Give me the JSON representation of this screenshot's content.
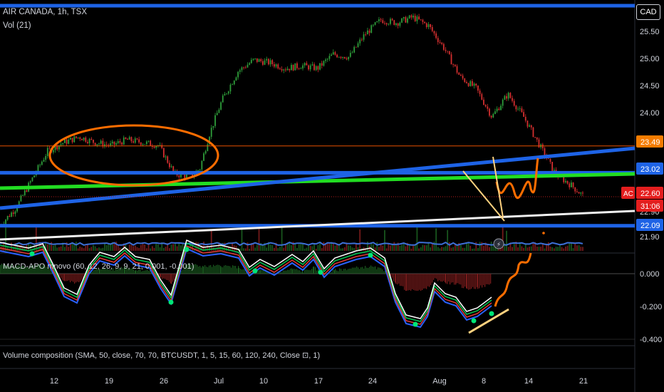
{
  "header": {
    "symbol_line": "AIR CANADA, 1h, TSX",
    "volume_label": "Vol (21)",
    "currency": "CAD"
  },
  "panes": {
    "macd_label": "MACD-APO mnovo (60, 12, 26, 9, 9, 21, 0.001, -0.001)",
    "volume_composition_label": "Volume composition (SMA, 50, close, 70, 70, BTCUSDT, 1, 5, 15, 60, 120, 240, Close ⊡, 1)"
  },
  "colors": {
    "up": "#26a69a",
    "up_candle": "#2e9d3a",
    "down": "#d32f2f",
    "blue_line": "#1e63e6",
    "green_line": "#22dd22",
    "orange": "#ff6d00",
    "white_line": "#f0f0f0",
    "yellow_marker": "#ffd27f",
    "price_tag_current": "#e41e1e",
    "price_tag_orange": "#f57c00",
    "price_tag_blue": "#1e63e6",
    "axis_text": "#d1d4dc"
  },
  "chart_data": [
    {
      "type": "candlestick",
      "title": "AIR CANADA, 1h, TSX",
      "y_axis_ticks": [
        "25.50",
        "25.00",
        "24.50",
        "24.00",
        "22.90",
        "21.90"
      ],
      "ylim": [
        21.8,
        25.8
      ],
      "x_axis_ticks": [
        "12",
        "19",
        "26",
        "Jul",
        "10",
        "17",
        "24",
        "Aug",
        "8",
        "14",
        "21"
      ],
      "price_labels": [
        {
          "value": "23.49",
          "style": "orange"
        },
        {
          "value": "23.02",
          "style": "blue"
        },
        {
          "value": "22.60",
          "style": "current",
          "symbol": "AC"
        },
        {
          "value": "31:06",
          "style": "countdown"
        },
        {
          "value": "22.09",
          "style": "blue"
        }
      ],
      "close_path": [
        {
          "x": 0,
          "y": 22.1
        },
        {
          "x": 5,
          "y": 22.4
        },
        {
          "x": 10,
          "y": 22.9
        },
        {
          "x": 15,
          "y": 23.4
        },
        {
          "x": 20,
          "y": 23.55
        },
        {
          "x": 25,
          "y": 23.65
        },
        {
          "x": 30,
          "y": 23.55
        },
        {
          "x": 35,
          "y": 23.5
        },
        {
          "x": 40,
          "y": 23.6
        },
        {
          "x": 45,
          "y": 23.55
        },
        {
          "x": 50,
          "y": 23.5
        },
        {
          "x": 55,
          "y": 23.0
        },
        {
          "x": 60,
          "y": 22.95
        },
        {
          "x": 63,
          "y": 23.1
        },
        {
          "x": 66,
          "y": 23.7
        },
        {
          "x": 70,
          "y": 24.3
        },
        {
          "x": 75,
          "y": 24.8
        },
        {
          "x": 80,
          "y": 25.0
        },
        {
          "x": 85,
          "y": 24.95
        },
        {
          "x": 90,
          "y": 24.85
        },
        {
          "x": 95,
          "y": 24.9
        },
        {
          "x": 100,
          "y": 24.85
        },
        {
          "x": 105,
          "y": 25.1
        },
        {
          "x": 110,
          "y": 25.05
        },
        {
          "x": 115,
          "y": 25.45
        },
        {
          "x": 120,
          "y": 25.7
        },
        {
          "x": 125,
          "y": 25.65
        },
        {
          "x": 130,
          "y": 25.75
        },
        {
          "x": 135,
          "y": 25.6
        },
        {
          "x": 140,
          "y": 25.2
        },
        {
          "x": 145,
          "y": 24.7
        },
        {
          "x": 150,
          "y": 24.5
        },
        {
          "x": 155,
          "y": 24.0
        },
        {
          "x": 160,
          "y": 24.4
        },
        {
          "x": 165,
          "y": 24.0
        },
        {
          "x": 170,
          "y": 23.5
        },
        {
          "x": 175,
          "y": 23.0
        },
        {
          "x": 180,
          "y": 22.8
        },
        {
          "x": 184,
          "y": 22.6
        }
      ],
      "lines": [
        {
          "name": "",
          "color": "blue",
          "from": [
            0,
            25.95
          ],
          "to": [
            200,
            25.95
          ]
        },
        {
          "name": "",
          "color": "blue",
          "from": [
            0,
            23.02
          ],
          "to": [
            200,
            23.02
          ]
        },
        {
          "name": "",
          "color": "blue",
          "from": [
            0,
            22.09
          ],
          "to": [
            200,
            22.09
          ]
        },
        {
          "name": "",
          "color": "green",
          "from": [
            0,
            22.75
          ],
          "to": [
            200,
            23.0
          ]
        },
        {
          "name": "",
          "color": "blue",
          "from": [
            0,
            22.4
          ],
          "to": [
            200,
            23.45
          ]
        },
        {
          "name": "",
          "color": "white",
          "from": [
            0,
            21.85
          ],
          "to": [
            200,
            22.35
          ]
        },
        {
          "name": "",
          "color": "orange_thin",
          "from": [
            0,
            23.49
          ],
          "to": [
            200,
            23.49
          ]
        },
        {
          "name": "",
          "color": "red_dotted",
          "from": [
            0,
            22.6
          ],
          "to": [
            200,
            22.6
          ]
        }
      ]
    },
    {
      "type": "line",
      "title": "MACD-APO mnovo (60, 12, 26, 9, 9, 21, 0.001, -0.001)",
      "y_axis_ticks": [
        "0.000",
        "-0.200",
        "-0.400"
      ],
      "ylim": [
        -0.42,
        0.05
      ]
    }
  ],
  "time_badge": "⚡"
}
